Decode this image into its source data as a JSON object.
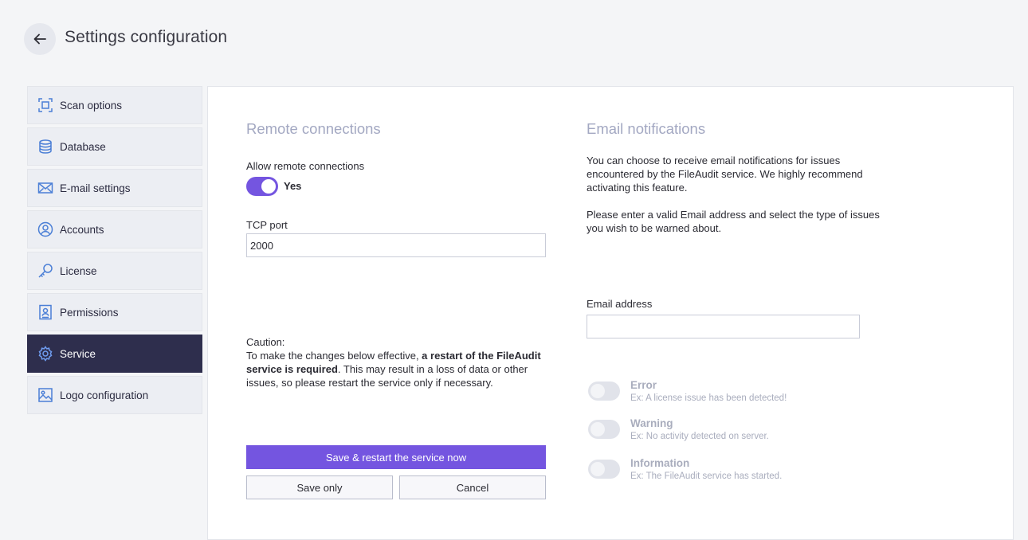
{
  "header": {
    "title": "Settings configuration"
  },
  "sidebar": {
    "items": [
      {
        "label": "Scan options",
        "icon": "scan-icon",
        "active": false
      },
      {
        "label": "Database",
        "icon": "database-icon",
        "active": false
      },
      {
        "label": "E-mail settings",
        "icon": "envelope-icon",
        "active": false
      },
      {
        "label": "Accounts",
        "icon": "user-circle-icon",
        "active": false
      },
      {
        "label": "License",
        "icon": "key-icon",
        "active": false
      },
      {
        "label": "Permissions",
        "icon": "badge-icon",
        "active": false
      },
      {
        "label": "Service",
        "icon": "gear-icon",
        "active": true
      },
      {
        "label": "Logo configuration",
        "icon": "image-icon",
        "active": false
      }
    ]
  },
  "remote": {
    "title": "Remote connections",
    "allow_label": "Allow remote connections",
    "allow_state": "Yes",
    "port_label": "TCP port",
    "port_value": "2000",
    "caution_heading": "Caution:",
    "caution_pre": "To make the changes below effective, ",
    "caution_bold1": "a restart of the FileAudit service is required",
    "caution_post": ". This may result in a loss of data or other issues, so please restart the service only if necessary.",
    "save_restart_label": "Save & restart the service now",
    "save_only_label": "Save only",
    "cancel_label": "Cancel"
  },
  "email": {
    "title": "Email notifications",
    "desc1": "You can choose to receive email notifications for issues encountered by the FileAudit service. We highly recommend activating this feature.",
    "desc2": "Please enter a valid Email address and select the type of issues you wish to be warned about.",
    "address_label": "Email address",
    "address_value": "",
    "notifications": [
      {
        "title": "Error",
        "example": "Ex: A license issue has been detected!",
        "enabled": false
      },
      {
        "title": "Warning",
        "example": "Ex: No activity detected on server.",
        "enabled": false
      },
      {
        "title": "Information",
        "example": "Ex: The FileAudit service has started.",
        "enabled": false
      }
    ]
  },
  "colors": {
    "accent": "#7455e0",
    "sidebar_active": "#2e2e4d",
    "section_title": "#a3a8c2"
  }
}
